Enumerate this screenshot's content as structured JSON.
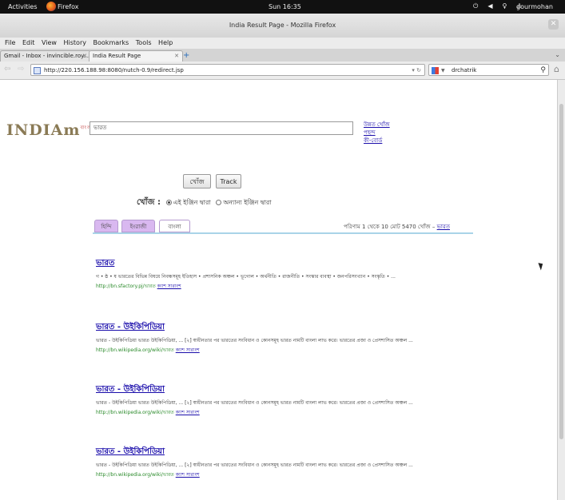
{
  "system_bar": {
    "activities": "Activities",
    "app": "Firefox",
    "clock": "Sun 16:35",
    "user": "gourmohan"
  },
  "window": {
    "title": "India Result Page - Mozilla Firefox"
  },
  "menu": [
    "File",
    "Edit",
    "View",
    "History",
    "Bookmarks",
    "Tools",
    "Help"
  ],
  "tabs": [
    {
      "label": "Gmail - Inbox - invincible.roy..."
    },
    {
      "label": "India Result Page"
    }
  ],
  "nav": {
    "url": "http://220.156.188.98:8080/nutch-0.9/redirect.jsp",
    "search_engine_query": "drchatrik"
  },
  "page": {
    "logo": "INDIAm",
    "logo_sup": "বাংলা",
    "query": "ভারত",
    "side_links": [
      "উন্নত খোঁজ",
      "পছন্দ",
      "কী-বোর্ড"
    ],
    "search_button": "খোঁজ",
    "track_button": "Track",
    "scope_label": "খোঁজ :",
    "scope_options": [
      "এই ইঞ্জিন দ্বারা",
      "অন্যান্য ইঞ্জিন দ্বারা"
    ],
    "lang_tabs": [
      "হিন্দি",
      "ইংরাজী",
      "বাংলা"
    ],
    "result_count": "পরিণাম 1 থেকে 10 মোট 5470 খোঁজ –",
    "result_count_link": "ভারত",
    "results": [
      {
        "title": "ভারত",
        "snippet": "গ • ষ্ঠ • ষ ভারতের বিভিন্ন বিষয়ে নিবন্ধসমূহ ইতিহাস • প্রশাসনিক অঞ্চল • ভূগোল • অর্থনীতি • রাজনীতি • সংস্কার ব্যবস্থা • জনপরিসংখ্যান • সংস্কৃতি • ...",
        "url": "http://bn.sfactory.pj/ভারত",
        "links": "ক্যাশ সারাংশ"
      },
      {
        "title": "ভারত - উইকিপিডিয়া",
        "snippet": "ভারত - উইকিপিডিয়া ভারত উইকিপিডিয়া, ... [২] স্বাধীনতার পর ভারতের সংবিধান ও কোনসমূহ ভারত নামটি বাংলা লাভ করে। ভারতের প্রজা ও প্রেসশাসিত অঞ্চল ...",
        "url": "http://bn.wikipedia.org/wiki/ভারত",
        "links": "ক্যাশ সারাংশ"
      },
      {
        "title": "ভারত - উইকিপিডিয়া",
        "snippet": "ভারত - উইকিপিডিয়া ভারত উইকিপিডিয়া, ... [২] স্বাধীনতার পর ভারতের সংবিধান ও কোনসমূহ ভারত নামটি বাংলা লাভ করে। ভারতের প্রজা ও প্রেসশাসিত অঞ্চল ...",
        "url": "http://bn.wikipedia.org/wiki/ভারত",
        "links": "ক্যাশ সারাংশ"
      },
      {
        "title": "ভারত - উইকিপিডিয়া",
        "snippet": "ভারত - উইকিপিডিয়া ভারত উইকিপিডিয়া, ... [২] স্বাধীনতার পর ভারতের সংবিধান ও কোনসমূহ ভারত নামটি বাংলা লাভ করে। ভারতের প্রজা ও প্রেসশাসিত অঞ্চল ...",
        "url": "http://bn.wikipedia.org/wiki/ভারত",
        "links": "ক্যাশ সারাংশ"
      }
    ]
  },
  "colors": {
    "link": "#1a0dab",
    "url_green": "#2a8a2a",
    "tab_purple": "#d9b8f0",
    "rule_blue": "#a9d4e8"
  }
}
